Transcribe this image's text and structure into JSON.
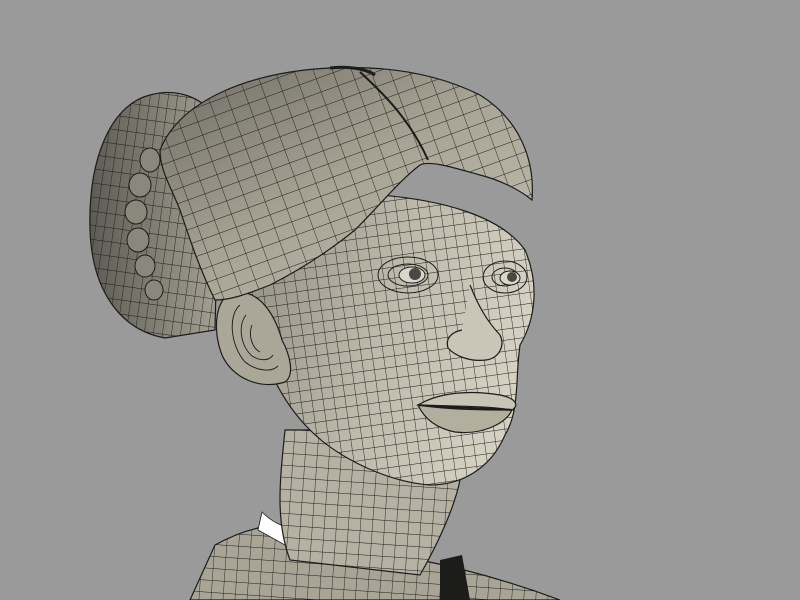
{
  "scene": {
    "subject": "wireframe-head-model",
    "background_color": "#9a9a9a",
    "mesh_fill_color": "#bdb9aa",
    "mesh_shade_color": "#6f6c62",
    "wire_color": "#1c1c1a",
    "highlight_color": "#ffffff"
  }
}
